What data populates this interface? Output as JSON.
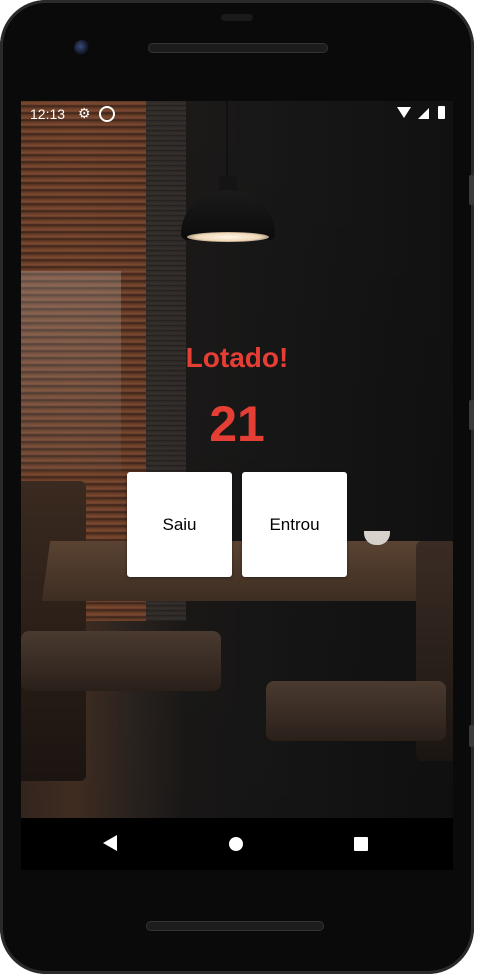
{
  "status_bar": {
    "time": "12:13",
    "icons": [
      "gear-icon",
      "sync-icon",
      "wifi-icon",
      "signal-icon",
      "battery-icon"
    ]
  },
  "main": {
    "title": "Lotado!",
    "count": "21",
    "buttons": {
      "saiu": "Saiu",
      "entrou": "Entrou"
    }
  },
  "nav_bar": {
    "icons": [
      "back-icon",
      "home-icon",
      "recents-icon"
    ]
  },
  "colors": {
    "accent": "#e53e34",
    "button_bg": "#ffffff"
  }
}
